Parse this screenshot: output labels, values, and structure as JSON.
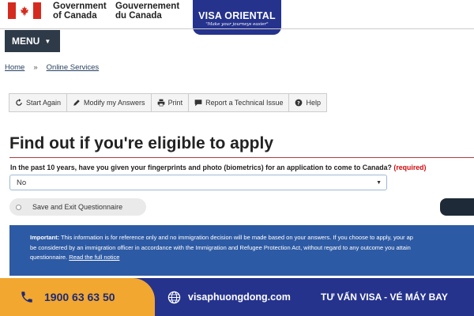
{
  "header": {
    "gov_en_line1": "Government",
    "gov_en_line2": "of Canada",
    "gov_fr_line1": "Gouvernement",
    "gov_fr_line2": "du Canada"
  },
  "badge": {
    "name": "VISA ORIENTAL",
    "tagline": "\"Make your journeys easier\""
  },
  "menu": {
    "label": "MENU"
  },
  "breadcrumb": {
    "home": "Home",
    "separator": "»",
    "current": "Online Services"
  },
  "toolbar": {
    "items": [
      {
        "label": "Start Again",
        "icon": "refresh-icon"
      },
      {
        "label": "Modify my Answers",
        "icon": "pencil-icon"
      },
      {
        "label": "Print",
        "icon": "printer-icon"
      },
      {
        "label": "Report a Technical Issue",
        "icon": "comment-icon"
      },
      {
        "label": "Help",
        "icon": "help-icon"
      }
    ]
  },
  "page": {
    "title": "Find out if you're eligible to apply",
    "question": "In the past 10 years, have you given your fingerprints and photo (biometrics) for an application to come to Canada?",
    "required": "(required)",
    "answer": "No",
    "save_exit": "Save and Exit Questionnaire"
  },
  "notice": {
    "label": "Important:",
    "line1": "This information is for reference only and no immigration decision will be made based on your answers. If you choose to apply, your ap",
    "line2": "be considered by an immigration officer in accordance with the Immigration and Refugee Protection Act, without regard to any outcome you attain",
    "line3": "questionnaire.",
    "link": "Read the full notice"
  },
  "footer": {
    "phone": "1900 63 63 50",
    "website": "visaphuongdong.com",
    "slogan": "TƯ VẤN VISA - VÉ MÁY BAY"
  },
  "colors": {
    "canada_red": "#d52b1e",
    "nav_dark": "#2e3a48",
    "brand_blue": "#25338d",
    "notice_blue": "#2d5aa4",
    "footer_orange": "#f2a730",
    "required_red": "#d3080c"
  }
}
